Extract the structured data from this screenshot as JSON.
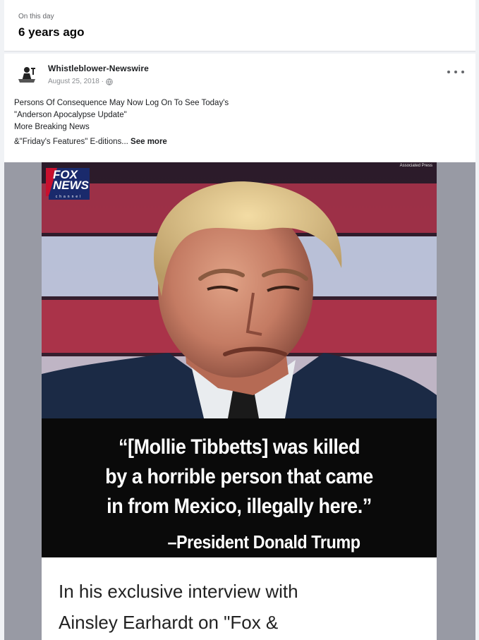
{
  "memory": {
    "kicker": "On this day",
    "title": "6 years ago"
  },
  "post": {
    "page_name": "Whistleblower-Newswire",
    "date": "August 25, 2018 ·",
    "privacy_icon": "globe-icon",
    "more_icon": "more-options-icon",
    "text_lines": [
      "Persons Of Consequence May Now Log On To See Today's",
      "\"Anderson Apocalypse Update\"",
      "More Breaking News",
      "&\"Friday's Features\" E-ditions..."
    ],
    "see_more_label": "See more"
  },
  "image": {
    "credit": "Associated Press",
    "logo": {
      "fox": "FOX",
      "news": "NEWS",
      "channel": "channel"
    },
    "quote_lines": [
      "“[Mollie Tibbetts] was killed",
      "by a horrible person that came",
      "in from Mexico, illegally here.”"
    ],
    "attribution": "–President Donald Trump",
    "caption_lines": [
      "In his exclusive interview with",
      "Ainsley Earhardt on \"Fox &"
    ]
  }
}
